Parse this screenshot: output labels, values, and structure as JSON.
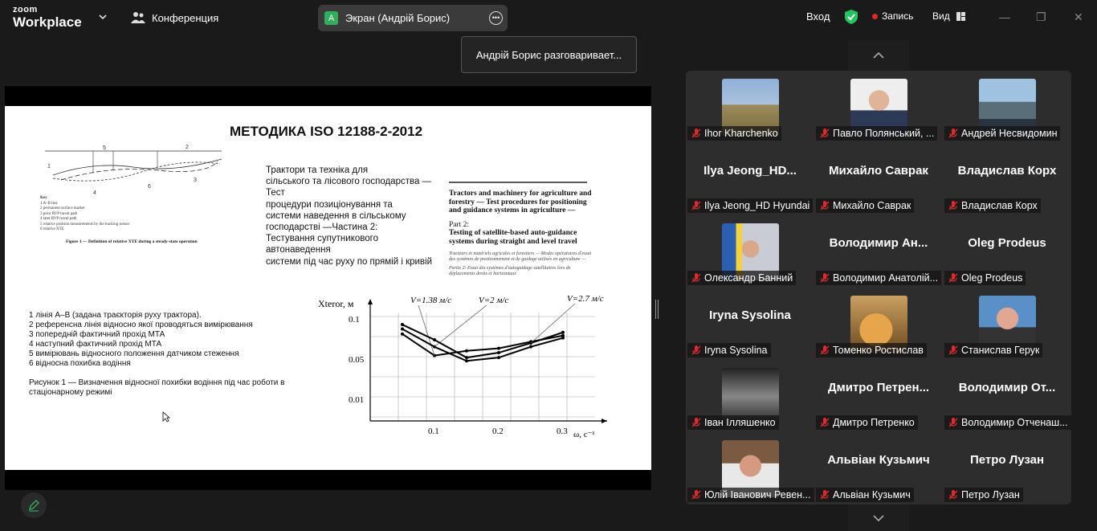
{
  "app": {
    "logo_top": "zoom",
    "logo_bottom": "Workplace",
    "meeting_label": "Конференция"
  },
  "share": {
    "avatar_letter": "A",
    "label": "Экран (Андрій Борис)",
    "speaking_tooltip": "Андрій Борис разговаривает..."
  },
  "toolbar": {
    "login": "Вход",
    "record": "Запись",
    "view": "Вид"
  },
  "colors": {
    "accent_green": "#2fae5b",
    "record_red": "#e02828",
    "shield_green": "#22c55e"
  },
  "slide": {
    "title": "МЕТОДИКА ISO 12188-2-2012",
    "ua_description": "Трактори та техніка для\nсільського та лісового господарства —\nТест\nпроцедури позиціонування та\nсистеми наведення в сільському\nгосподарстві —Частина 2:\nТестування супутникового\nавтонаведення\nсистеми під час руху по прямій і кривій",
    "en_title": "Tractors and machinery for agriculture and forestry — Test procedures for positioning and guidance systems in agriculture —",
    "en_part_label": "Part 2:",
    "en_part_title": "Testing of satellite-based auto-guidance systems during straight and level travel",
    "fr_small": "Tracteurs et matériels agricoles et forestiers — Modes opératoires d'essai des systèmes de positionnement et de guidage utilisés en agriculture —",
    "fr_part": "Partie 2: Essai des systèmes d'autoguidage satellitaires lors de déplacements droits et horizontaux",
    "figure_caption_en": "Figure 1 — Definition of relative XTE during a steady-state operation",
    "figure_key": [
      "Key",
      "1   A–B line",
      "2   permanent surface marker",
      "3   prior RVP travel path",
      "4   later RVP travel path",
      "5   relative position measurements by the tracking sensor",
      "6   relative XTE"
    ],
    "legend": [
      "1 лінія А–В (задана траєкторія руху трактора).",
      "2 референсна лінія відносно якої проводяться вимірювання",
      "3 попередній фактичний прохід МТА",
      "4 наступний фактичний прохід МТА",
      "5 вимірювань відносного положення датчиком стеження",
      "6 відносна похибка водіння"
    ],
    "figure1_caption": "Рисунок 1 — Визначення відносної похибки водіння під час роботи в стаціонарному режимі"
  },
  "chart_data": {
    "type": "line",
    "ylabel": "Xteror, м",
    "xlabel": "ω, с⁻¹",
    "x_ticks": [
      "0.1",
      "0.2",
      "0.3"
    ],
    "y_ticks": [
      "0.1",
      "0.05",
      "0.01"
    ],
    "series": [
      {
        "name": "V=1.38 м/с",
        "x": [
          0.05,
          0.1,
          0.15,
          0.2,
          0.25,
          0.3
        ],
        "y": [
          0.065,
          0.035,
          0.04,
          0.043,
          0.052,
          0.062
        ]
      },
      {
        "name": "V=2 м/с",
        "x": [
          0.05,
          0.1,
          0.15,
          0.2,
          0.25,
          0.3
        ],
        "y": [
          0.075,
          0.045,
          0.03,
          0.033,
          0.045,
          0.058
        ]
      },
      {
        "name": "V=2.7 м/с",
        "x": [
          0.05,
          0.1,
          0.15,
          0.2,
          0.25,
          0.3
        ],
        "y": [
          0.085,
          0.055,
          0.033,
          0.038,
          0.05,
          0.068
        ]
      }
    ]
  },
  "participants": [
    {
      "name": "Ihor Kharchenko",
      "photo": "field"
    },
    {
      "name": "Павло Полянський, ...",
      "photo": "man-suit"
    },
    {
      "name": "Андрей Несвидомин",
      "photo": "street"
    },
    {
      "name": "Ilya Jeong_HD Hyundai",
      "big": "Ilya  Jeong_HD..."
    },
    {
      "name": "Михайло Саврак",
      "big": "Михайло Саврак"
    },
    {
      "name": "Владислав Корх",
      "big": "Владислав Корх"
    },
    {
      "name": "Олександр Банний",
      "photo": "flag-man"
    },
    {
      "name": "Володимир Анатолій...",
      "big": "Володимир  Ан..."
    },
    {
      "name": "Oleg Prodeus",
      "big": "Oleg Prodeus"
    },
    {
      "name": "Iryna Sysolina",
      "big": "Iryna Sysolina"
    },
    {
      "name": "Томенко Ростислав",
      "photo": "cat"
    },
    {
      "name": "Станислав Герук",
      "photo": "older-man"
    },
    {
      "name": "Іван Ілляшенко",
      "photo": "bw"
    },
    {
      "name": "Дмитро Петренко",
      "big": "Дмитро  Петрен..."
    },
    {
      "name": "Володимир Отченаш...",
      "big": "Володимир  От..."
    },
    {
      "name": "Юлій Іванович Ревен...",
      "photo": "glasses-man"
    },
    {
      "name": "Альвіан Кузьмич",
      "big": "Альвіан Кузьмич"
    },
    {
      "name": "Петро Лузан",
      "big": "Петро Лузан"
    }
  ]
}
